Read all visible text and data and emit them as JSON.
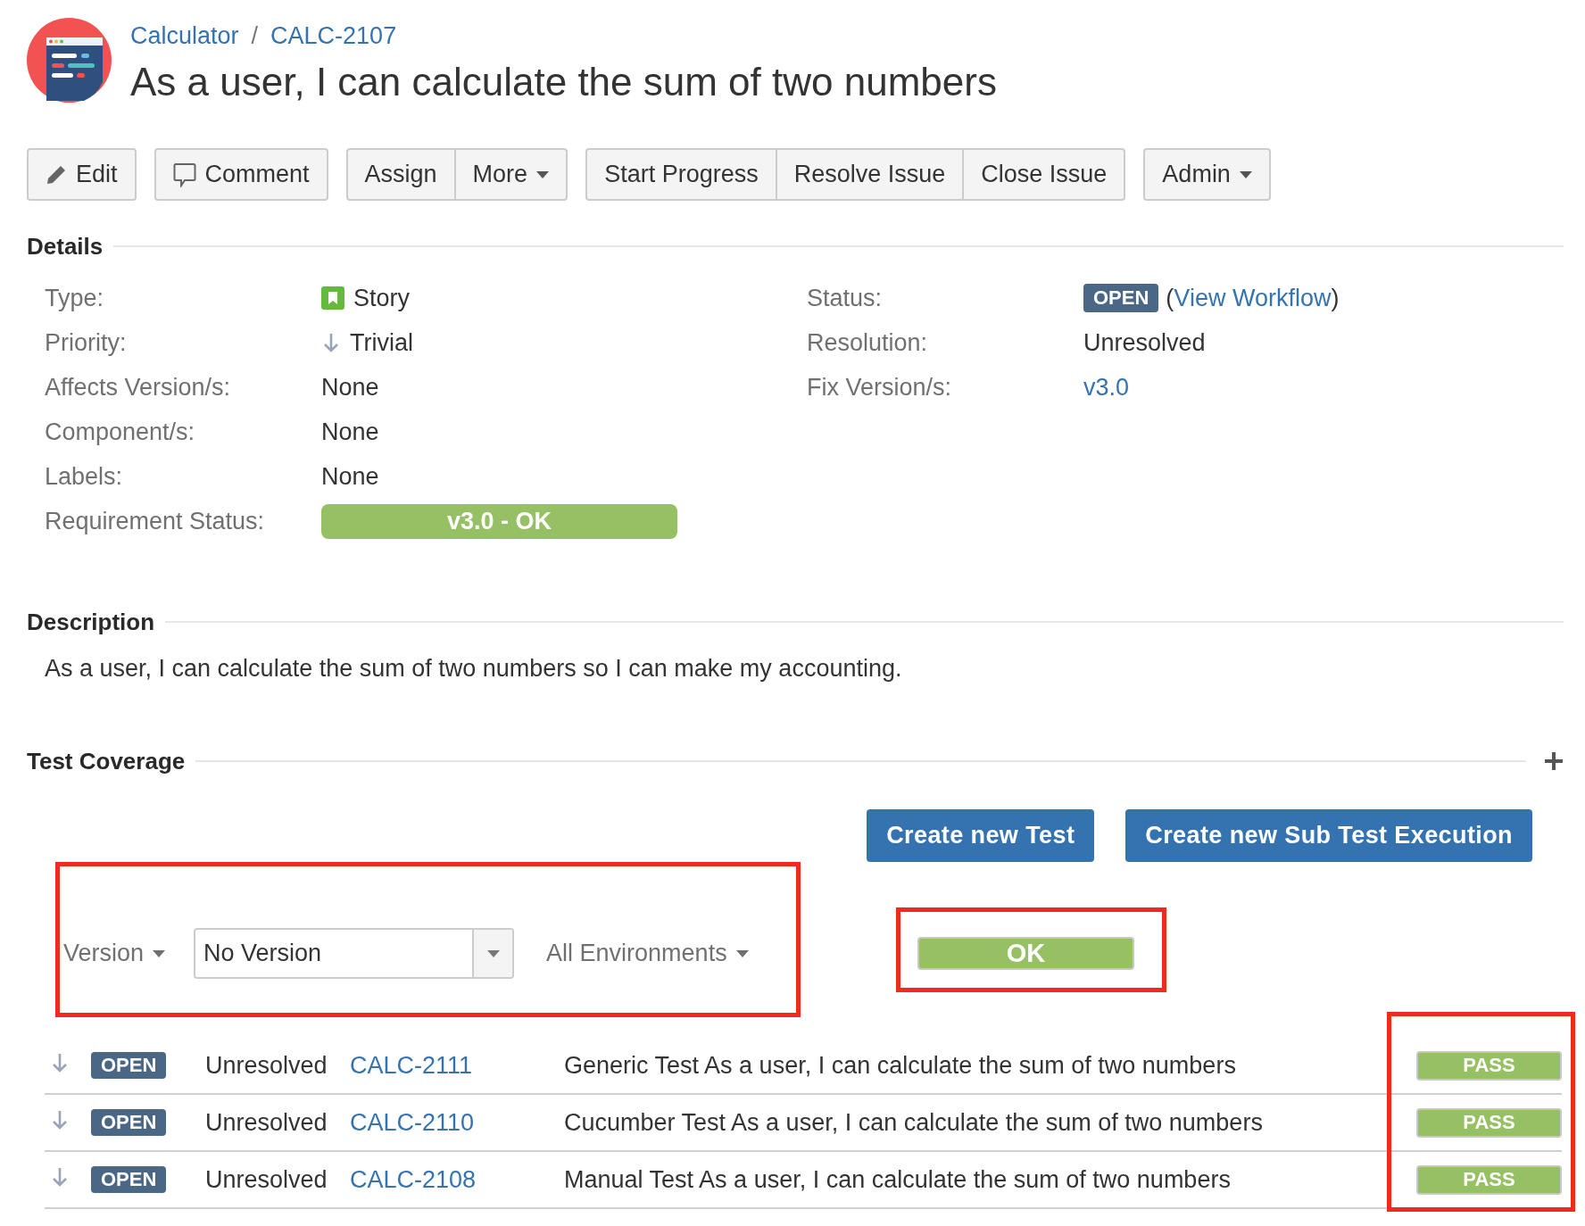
{
  "breadcrumb": {
    "project": "Calculator",
    "separator": "/",
    "issue_key": "CALC-2107"
  },
  "title": "As a user, I can calculate the sum of two numbers",
  "toolbar": [
    {
      "buttons": [
        {
          "label": "Edit",
          "kind": "edit"
        }
      ]
    },
    {
      "buttons": [
        {
          "label": "Comment",
          "kind": "comment"
        }
      ]
    },
    {
      "buttons": [
        {
          "label": "Assign",
          "kind": "plain"
        },
        {
          "label": "More",
          "kind": "menu"
        }
      ]
    },
    {
      "buttons": [
        {
          "label": "Start Progress",
          "kind": "plain"
        },
        {
          "label": "Resolve Issue",
          "kind": "plain"
        },
        {
          "label": "Close Issue",
          "kind": "plain"
        }
      ]
    },
    {
      "buttons": [
        {
          "label": "Admin",
          "kind": "menu"
        }
      ]
    }
  ],
  "details": {
    "heading": "Details",
    "left": [
      {
        "label": "Type:",
        "kind": "type",
        "value": "Story"
      },
      {
        "label": "Priority:",
        "kind": "priority",
        "value": "Trivial"
      },
      {
        "label": "Affects Version/s:",
        "kind": "text",
        "value": "None"
      },
      {
        "label": "Component/s:",
        "kind": "text",
        "value": "None"
      },
      {
        "label": "Labels:",
        "kind": "text",
        "value": "None"
      },
      {
        "label": "Requirement Status:",
        "kind": "bar",
        "value": "v3.0 - OK"
      }
    ],
    "right": [
      {
        "label": "Status:",
        "kind": "status",
        "value": "OPEN",
        "before": "(",
        "link": "View Workflow",
        "after": ")"
      },
      {
        "label": "Resolution:",
        "kind": "text",
        "value": "Unresolved"
      },
      {
        "label": "Fix Version/s:",
        "kind": "link",
        "value": "v3.0"
      }
    ]
  },
  "description": {
    "heading": "Description",
    "text": "As a user, I can calculate the sum of two numbers so I can make my accounting."
  },
  "test_coverage": {
    "heading": "Test Coverage",
    "buttons": [
      "Create new Test",
      "Create new Sub Test Execution"
    ],
    "version_menu": "Version",
    "version_select": {
      "value": "No Version"
    },
    "environment_menu": "All Environments",
    "overall_status": "OK",
    "rows": [
      {
        "status": "OPEN",
        "resolution": "Unresolved",
        "key": "CALC-2111",
        "summary": "Generic Test As a user, I can calculate the sum of two numbers",
        "result": "PASS"
      },
      {
        "status": "OPEN",
        "resolution": "Unresolved",
        "key": "CALC-2110",
        "summary": "Cucumber Test As a user, I can calculate the sum of two numbers",
        "result": "PASS"
      },
      {
        "status": "OPEN",
        "resolution": "Unresolved",
        "key": "CALC-2108",
        "summary": "Manual Test As a user, I can calculate the sum of two numbers",
        "result": "PASS"
      }
    ]
  }
}
